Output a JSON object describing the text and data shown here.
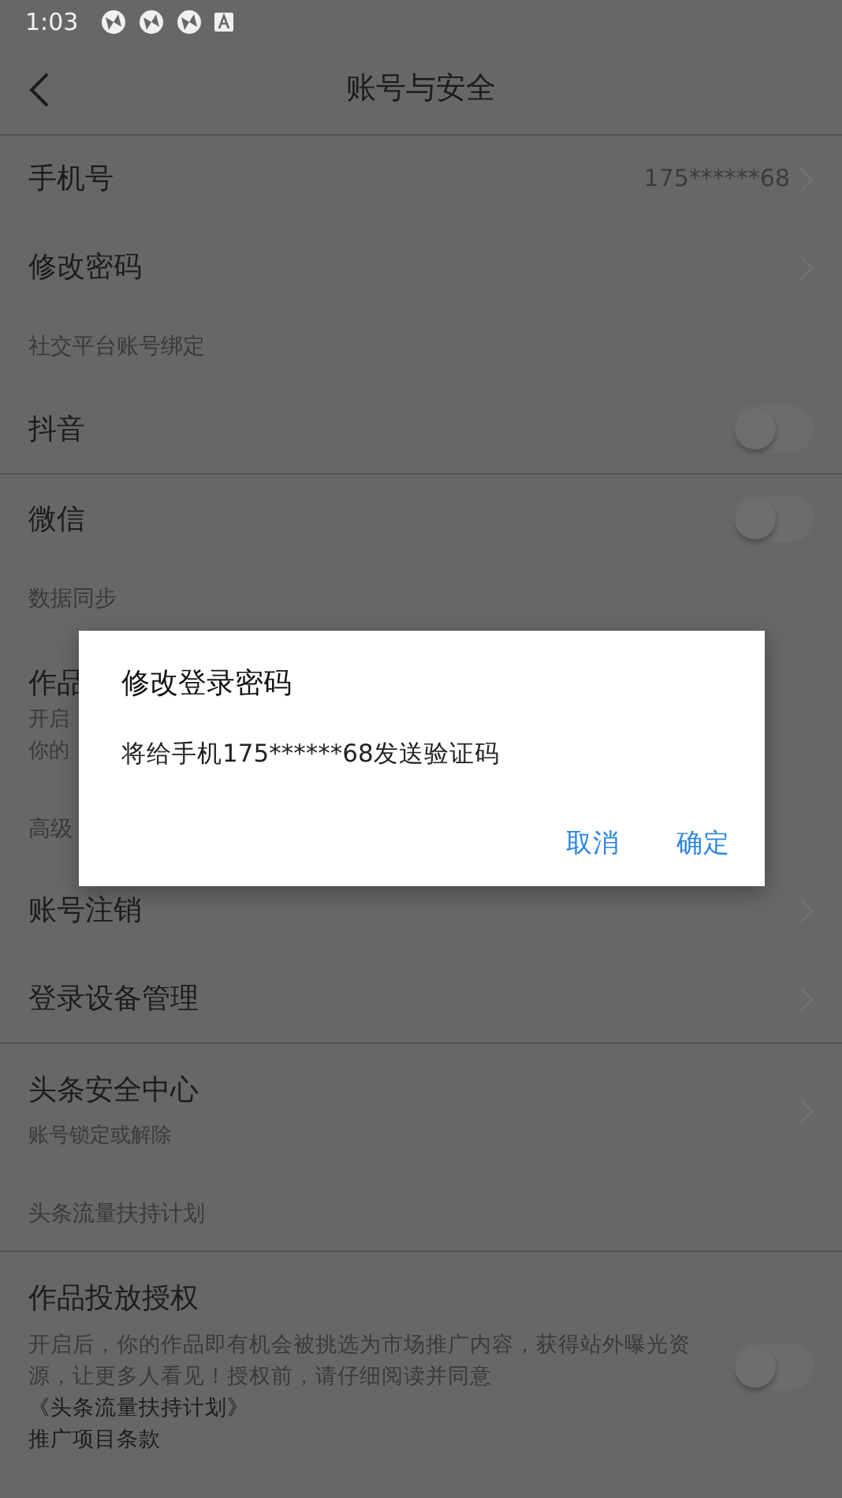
{
  "status_bar": {
    "time": "1:03"
  },
  "header": {
    "title": "账号与安全"
  },
  "rows": [
    {
      "kind": "nav",
      "label": "手机号",
      "value": "175******68",
      "divider": false
    },
    {
      "kind": "nav",
      "label": "修改密码",
      "divider": false
    },
    {
      "kind": "section",
      "label": "社交平台账号绑定",
      "divider": false
    },
    {
      "kind": "toggle",
      "label": "抖音",
      "checked": false,
      "divider": true
    },
    {
      "kind": "toggle",
      "label": "微信",
      "checked": false,
      "divider": false
    },
    {
      "kind": "section",
      "label": "数据同步",
      "divider": false
    },
    {
      "kind": "detail",
      "label": "作品",
      "lines": [
        "开启",
        "你的"
      ],
      "divider": false
    },
    {
      "kind": "section",
      "label": "高级",
      "divider": false
    },
    {
      "kind": "nav",
      "label": "账号注销",
      "divider": false
    },
    {
      "kind": "nav",
      "label": "登录设备管理",
      "divider": true
    },
    {
      "kind": "nav",
      "label": "头条安全中心",
      "lines": [
        "账号锁定或解除"
      ],
      "divider": false
    },
    {
      "kind": "section",
      "label": "头条流量扶持计划",
      "divider": true
    },
    {
      "kind": "toggle",
      "label": "作品投放授权",
      "checked": false,
      "description": "开启后，你的作品即有机会被挑选为市场推广内容，获得站外曝光资源，让更多人看见！授权前，请仔细阅读并同意",
      "link": "《头条流量扶持计划》",
      "link_2": "推广项目条款",
      "divider": false
    }
  ],
  "dialog": {
    "title": "修改登录密码",
    "message": "将给手机175******68发送验证码",
    "buttons": [
      "取消",
      "确定"
    ]
  }
}
